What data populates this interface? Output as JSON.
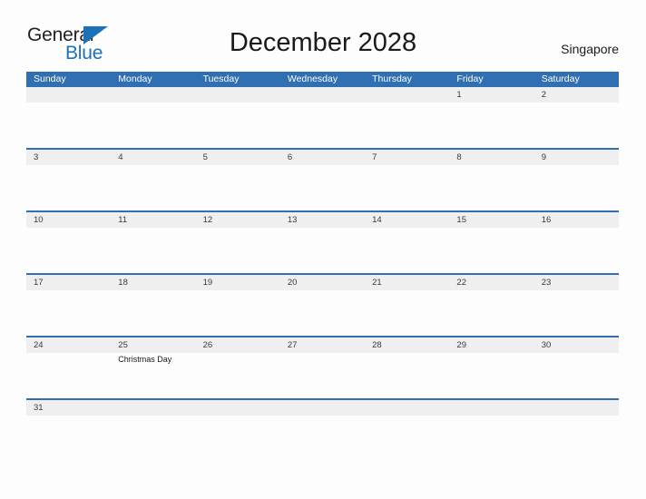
{
  "brand": {
    "name_part1": "General",
    "name_part2": "Blue",
    "accent_color": "#1b72b8",
    "flag_icon": "triangle-flag-icon"
  },
  "header": {
    "title": "December 2028",
    "region": "Singapore"
  },
  "calendar": {
    "header_bg_color": "#2f6fb2",
    "row_band_color": "#efefef",
    "row_border_color": "#2f6fb2",
    "day_names": [
      "Sunday",
      "Monday",
      "Tuesday",
      "Wednesday",
      "Thursday",
      "Friday",
      "Saturday"
    ],
    "weeks": [
      [
        {
          "num": "",
          "event": ""
        },
        {
          "num": "",
          "event": ""
        },
        {
          "num": "",
          "event": ""
        },
        {
          "num": "",
          "event": ""
        },
        {
          "num": "",
          "event": ""
        },
        {
          "num": "1",
          "event": ""
        },
        {
          "num": "2",
          "event": ""
        }
      ],
      [
        {
          "num": "3",
          "event": ""
        },
        {
          "num": "4",
          "event": ""
        },
        {
          "num": "5",
          "event": ""
        },
        {
          "num": "6",
          "event": ""
        },
        {
          "num": "7",
          "event": ""
        },
        {
          "num": "8",
          "event": ""
        },
        {
          "num": "9",
          "event": ""
        }
      ],
      [
        {
          "num": "10",
          "event": ""
        },
        {
          "num": "11",
          "event": ""
        },
        {
          "num": "12",
          "event": ""
        },
        {
          "num": "13",
          "event": ""
        },
        {
          "num": "14",
          "event": ""
        },
        {
          "num": "15",
          "event": ""
        },
        {
          "num": "16",
          "event": ""
        }
      ],
      [
        {
          "num": "17",
          "event": ""
        },
        {
          "num": "18",
          "event": ""
        },
        {
          "num": "19",
          "event": ""
        },
        {
          "num": "20",
          "event": ""
        },
        {
          "num": "21",
          "event": ""
        },
        {
          "num": "22",
          "event": ""
        },
        {
          "num": "23",
          "event": ""
        }
      ],
      [
        {
          "num": "24",
          "event": ""
        },
        {
          "num": "25",
          "event": "Christmas Day"
        },
        {
          "num": "26",
          "event": ""
        },
        {
          "num": "27",
          "event": ""
        },
        {
          "num": "28",
          "event": ""
        },
        {
          "num": "29",
          "event": ""
        },
        {
          "num": "30",
          "event": ""
        }
      ],
      [
        {
          "num": "31",
          "event": ""
        },
        {
          "num": "",
          "event": ""
        },
        {
          "num": "",
          "event": ""
        },
        {
          "num": "",
          "event": ""
        },
        {
          "num": "",
          "event": ""
        },
        {
          "num": "",
          "event": ""
        },
        {
          "num": "",
          "event": ""
        }
      ]
    ]
  }
}
